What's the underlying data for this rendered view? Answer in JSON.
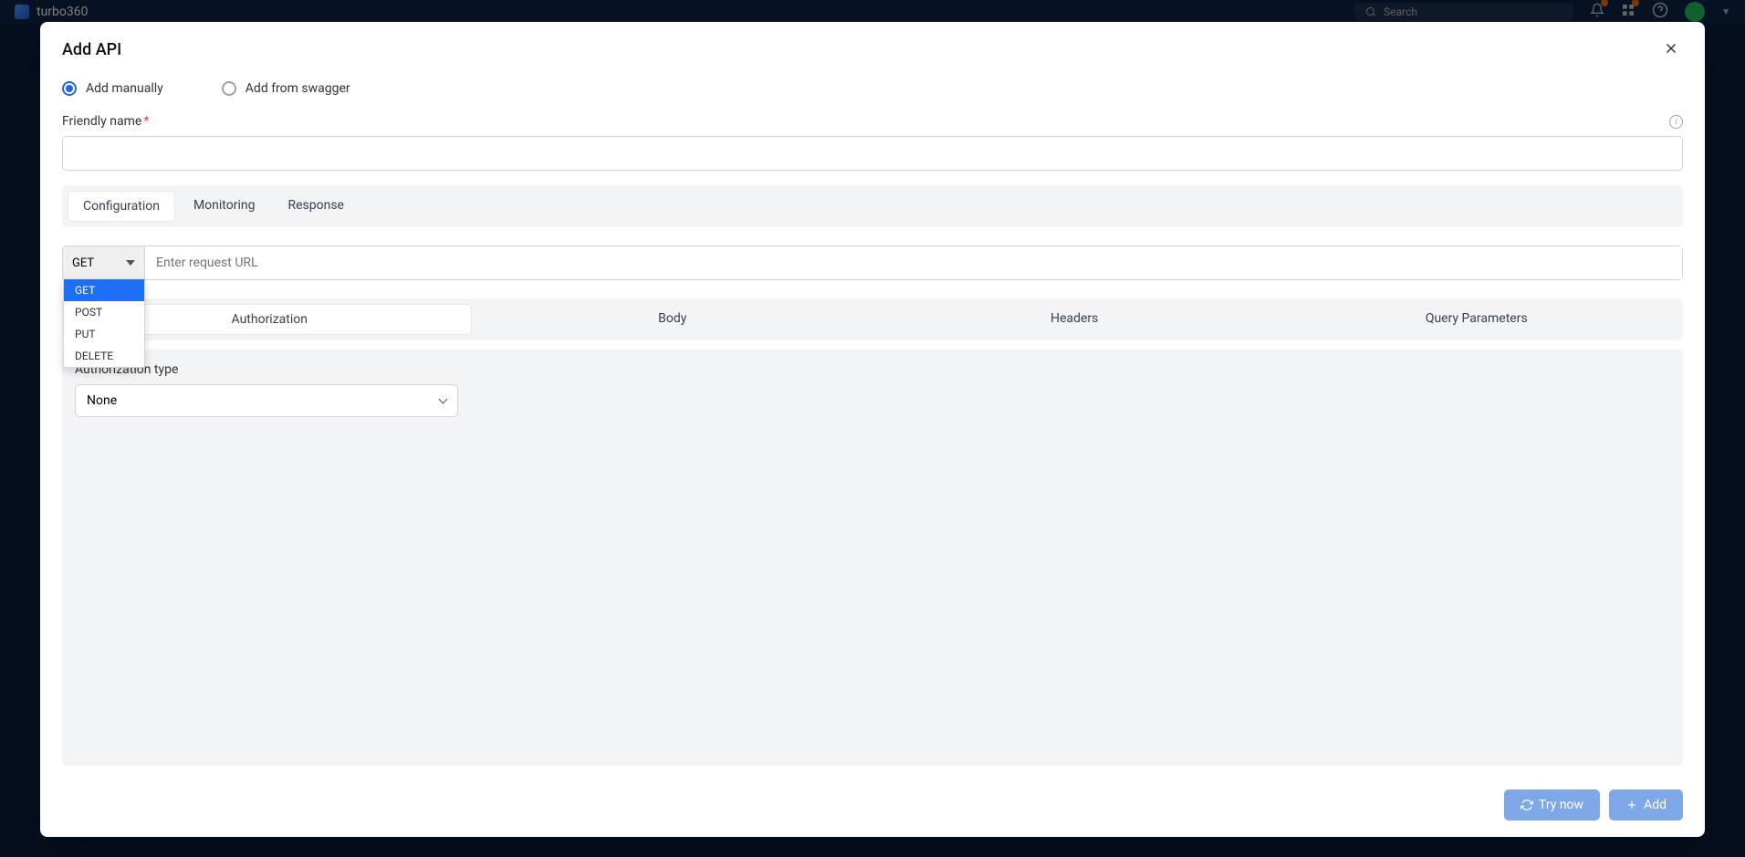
{
  "topbar": {
    "brand": "turbo360",
    "search_placeholder": "Search"
  },
  "modal": {
    "title": "Add API",
    "radios": {
      "manual": "Add manually",
      "swagger": "Add from swagger"
    },
    "friendly_label": "Friendly name",
    "tabs": {
      "config": "Configuration",
      "monitoring": "Monitoring",
      "response": "Response"
    },
    "request": {
      "method_selected": "GET",
      "url_placeholder": "Enter request URL",
      "method_options": [
        "GET",
        "POST",
        "PUT",
        "DELETE"
      ]
    },
    "sub_tabs": {
      "auth": "Authorization",
      "body": "Body",
      "headers": "Headers",
      "query": "Query Parameters"
    },
    "auth": {
      "label": "Authorization type",
      "value": "None"
    },
    "footer": {
      "try": "Try now",
      "add": "Add"
    }
  }
}
